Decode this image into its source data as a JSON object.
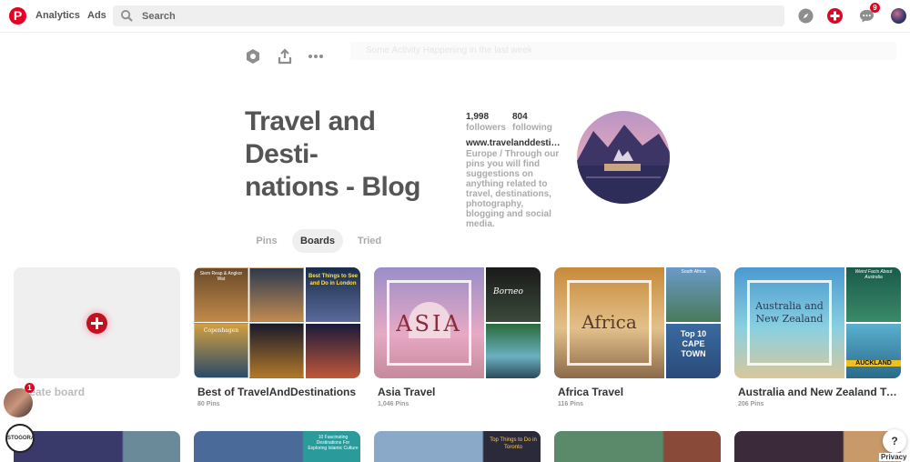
{
  "colors": {
    "brand": "#e60023",
    "tab_active_bg": "#efefef"
  },
  "header": {
    "nav": [
      "Analytics",
      "Ads"
    ],
    "search_placeholder": "Search",
    "message_badge": "9"
  },
  "toolbar": {
    "faded_banner": "Some Activity Happening in the last week"
  },
  "profile": {
    "title": "Travel and Desti-\nnations - Blog",
    "followers_count": "1,998",
    "followers_label": "followers",
    "following_count": "804",
    "following_label": "following",
    "website": "www.travelanddestinations.com",
    "bio": "Europe / Through our pins you will find suggestions on anything related to travel, destinations, photography, blogging and social media."
  },
  "tabs": [
    {
      "label": "Pins"
    },
    {
      "label": "Boards"
    },
    {
      "label": "Tried"
    }
  ],
  "boards": [
    {
      "name": "Create board"
    },
    {
      "name": "Best of TravelAndDestinations",
      "count": "80 Pins",
      "tiles": [
        "Best Things to See and Do in London",
        "Copenhagen",
        "Siem Reap & Angkor Wat"
      ]
    },
    {
      "name": "Asia Travel",
      "count": "1,046 Pins",
      "cover_text": "ASIA",
      "side_text": "Borneo"
    },
    {
      "name": "Africa Travel",
      "count": "116 Pins",
      "cover_text": "Africa",
      "side_text_1": "South Africa",
      "side_text_2": "Top 10 CAPE TOWN"
    },
    {
      "name": "Australia and New Zealand Travel",
      "count": "206 Pins",
      "cover_text": "Australia and New Zealand",
      "side_text_1": "Weird Facts About Australia",
      "side_text_2": "AUCKLAND"
    }
  ],
  "row2_labels": [
    "10 Fascinating Destinations For Exploring Islamic Culture",
    "Top Things to Do in Toronto"
  ],
  "notifications": {
    "inbox_badge": "1"
  },
  "footer": {
    "help": "?",
    "privacy": "Privacy",
    "stamp": "STOGORA"
  }
}
